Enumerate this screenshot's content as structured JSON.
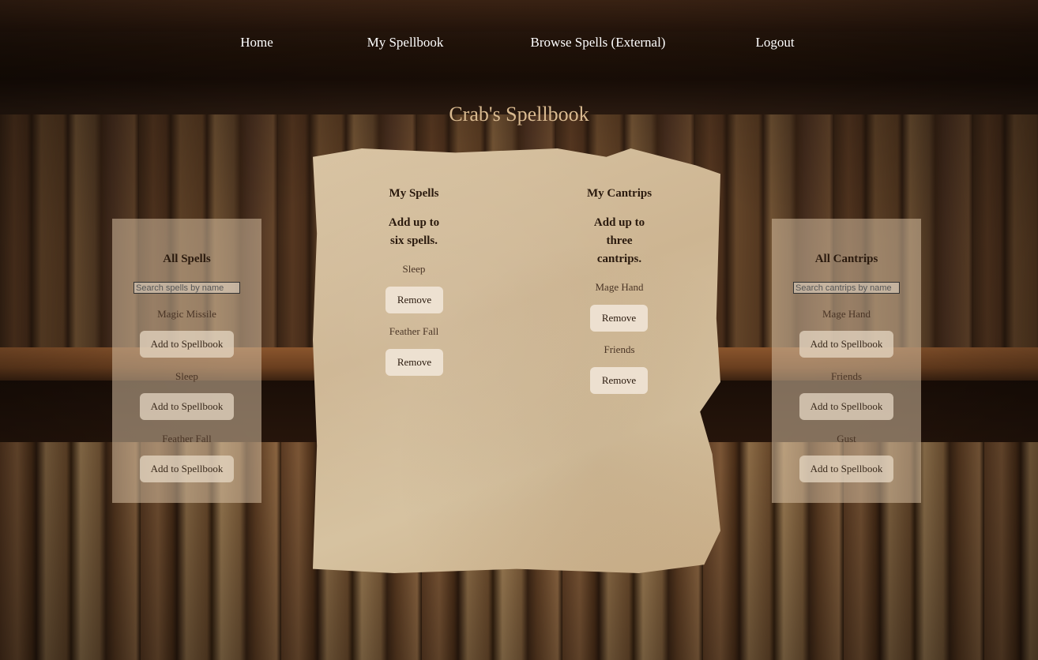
{
  "nav": {
    "home": "Home",
    "my_spellbook": "My Spellbook",
    "browse_spells": "Browse Spells (External)",
    "logout": "Logout"
  },
  "page_title": "Crab's Spellbook",
  "all_spells": {
    "title": "All Spells",
    "search_placeholder": "Search spells by name",
    "button_label": "Add to Spellbook",
    "items": [
      "Magic Missile",
      "Sleep",
      "Feather Fall"
    ]
  },
  "my_spells": {
    "title": "My Spells",
    "note": "Add up to six spells.",
    "button_label": "Remove",
    "items": [
      "Sleep",
      "Feather Fall"
    ]
  },
  "my_cantrips": {
    "title": "My Cantrips",
    "note": "Add up to three cantrips.",
    "button_label": "Remove",
    "items": [
      "Mage Hand",
      "Friends"
    ]
  },
  "all_cantrips": {
    "title": "All Cantrips",
    "search_placeholder": "Search cantrips by name",
    "button_label": "Add to Spellbook",
    "items": [
      "Mage Hand",
      "Friends",
      "Gust"
    ]
  }
}
